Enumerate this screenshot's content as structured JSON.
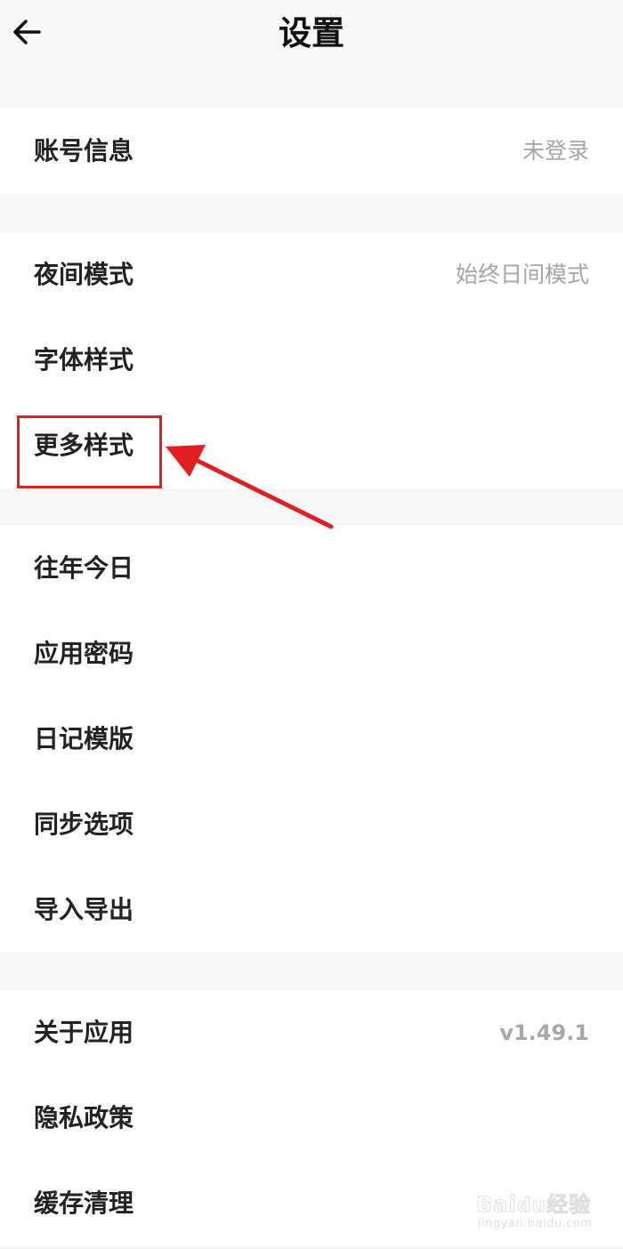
{
  "header": {
    "title": "设置",
    "back_icon": "arrow-left-icon"
  },
  "groups": [
    {
      "items": [
        {
          "label": "账号信息",
          "value": "未登录"
        }
      ]
    },
    {
      "items": [
        {
          "label": "夜间模式",
          "value": "始终日间模式"
        },
        {
          "label": "字体样式",
          "value": ""
        },
        {
          "label": "更多样式",
          "value": ""
        }
      ]
    },
    {
      "items": [
        {
          "label": "往年今日",
          "value": ""
        },
        {
          "label": "应用密码",
          "value": ""
        },
        {
          "label": "日记模版",
          "value": ""
        },
        {
          "label": "同步选项",
          "value": ""
        },
        {
          "label": "导入导出",
          "value": ""
        }
      ]
    },
    {
      "items": [
        {
          "label": "关于应用",
          "value": "v1.49.1"
        },
        {
          "label": "隐私政策",
          "value": ""
        },
        {
          "label": "缓存清理",
          "value": ""
        }
      ]
    }
  ],
  "annotation": {
    "highlight_color": "#e02020",
    "target": "更多样式"
  },
  "watermark": {
    "brand": "Baidu经验",
    "url": "jingyan.baidu.com"
  }
}
